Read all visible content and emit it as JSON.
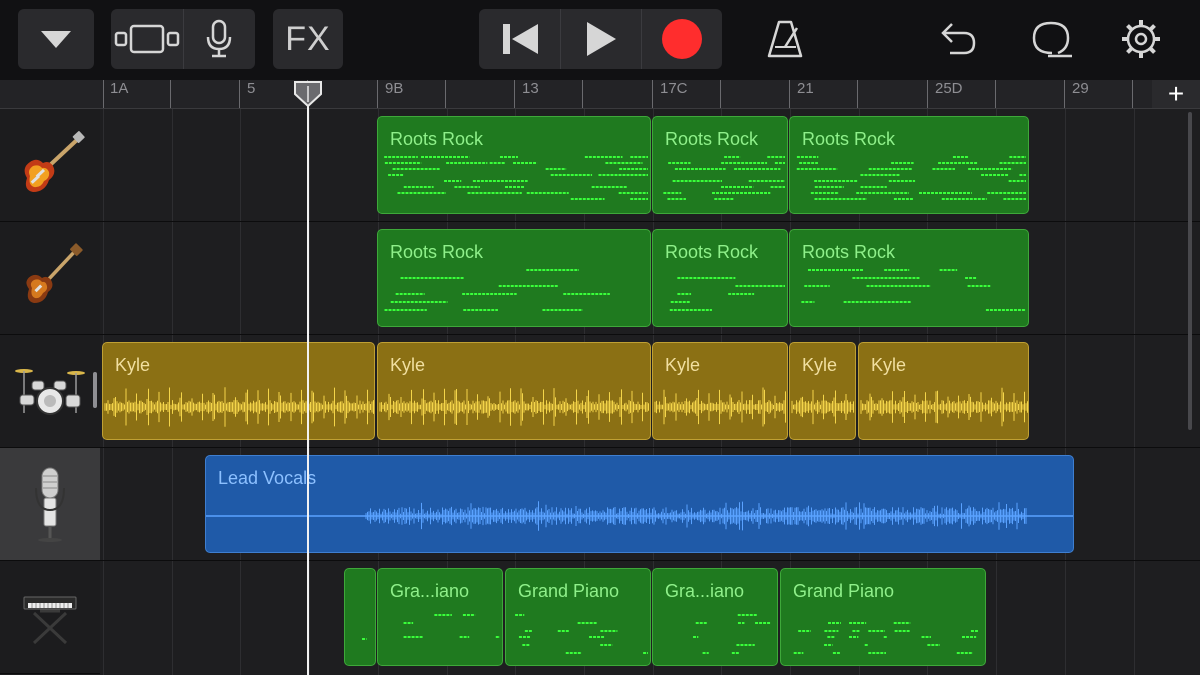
{
  "toolbar": {
    "fx_label": "FX",
    "icons": [
      "dropdown-triangle-icon",
      "track-view-icon",
      "microphone-icon",
      "rewind-icon",
      "play-icon",
      "record-icon",
      "metronome-icon",
      "undo-icon",
      "loop-icon",
      "settings-gear-icon"
    ],
    "record_color": "#ff2d2d"
  },
  "ruler": {
    "markers": [
      "1A",
      "5",
      "9B",
      "13",
      "17C",
      "21",
      "25D",
      "29"
    ],
    "add_label": "+"
  },
  "tracks": [
    {
      "instrument": "electric-guitar-icon",
      "regions": [
        {
          "label": "Roots Rock"
        },
        {
          "label": "Roots Rock"
        },
        {
          "label": "Roots Rock"
        }
      ]
    },
    {
      "instrument": "bass-guitar-icon",
      "regions": [
        {
          "label": "Roots Rock"
        },
        {
          "label": "Roots Rock"
        },
        {
          "label": "Roots Rock"
        }
      ]
    },
    {
      "instrument": "drum-kit-icon",
      "regions": [
        {
          "label": "Kyle"
        },
        {
          "label": "Kyle"
        },
        {
          "label": "Kyle"
        },
        {
          "label": "Kyle"
        },
        {
          "label": "Kyle"
        }
      ]
    },
    {
      "instrument": "studio-microphone-icon",
      "selected": true,
      "regions": [
        {
          "label": "Lead Vocals"
        }
      ]
    },
    {
      "instrument": "keyboard-stand-icon",
      "regions": [
        {
          "label": ""
        },
        {
          "label": "Gra...iano"
        },
        {
          "label": "Grand Piano"
        },
        {
          "label": "Gra...iano"
        },
        {
          "label": "Grand Piano"
        }
      ]
    }
  ],
  "colors": {
    "midi_region": "#1f7a1f",
    "midi_note": "#39ff3a",
    "audio_region": "#8b7014",
    "audio_wave": "#f4d54a",
    "vocal_region": "#1f5aa8",
    "vocal_wave": "#5aa2ff"
  }
}
